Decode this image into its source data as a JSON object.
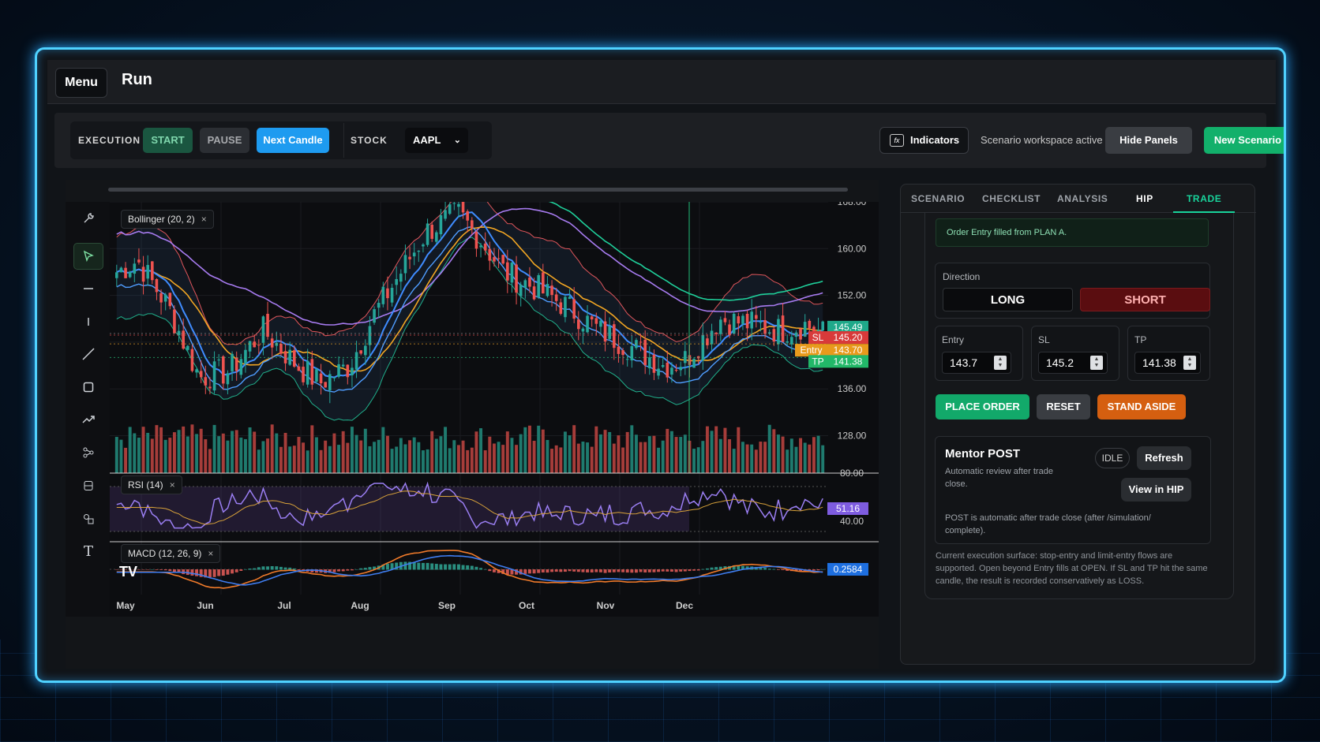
{
  "header": {
    "menu_label": "Menu",
    "title": "Run"
  },
  "toolbar": {
    "execution_label": "EXECUTION",
    "start_label": "START",
    "pause_label": "PAUSE",
    "next_candle_label": "Next Candle",
    "stock_label": "STOCK",
    "stock_value": "AAPL",
    "indicators_label": "Indicators",
    "indicators_icon": "fx",
    "workspace_status": "Scenario workspace active",
    "hide_panels_label": "Hide Panels",
    "new_scenario_label": "New Scenario"
  },
  "chart": {
    "legends": {
      "bollinger": "Bollinger (20, 2)",
      "rsi": "RSI (14)",
      "macd": "MACD (12, 26, 9)"
    },
    "close_glyph": "×",
    "price_ticks": [
      "168.00",
      "160.00",
      "152.00",
      "136.00",
      "128.00"
    ],
    "rsi_ticks": [
      "80.00",
      "40.00"
    ],
    "x_ticks": [
      "May",
      "Jun",
      "Jul",
      "Aug",
      "Sep",
      "Oct",
      "Nov",
      "Dec"
    ],
    "price_labels": {
      "last": "145.49",
      "sl_tag": "SL",
      "sl": "145.20",
      "entry_tag": "Entry",
      "entry": "143.70",
      "tp_tag": "TP",
      "tp": "141.38"
    },
    "rsi_value": "51.16",
    "macd_value": "0.2584",
    "logo": "TV",
    "colors": {
      "up": "#26a69a",
      "down": "#ef5350",
      "bollinger": "#e0565b",
      "ma_fast": "#3f8cff",
      "ma_slow": "#f2a623",
      "ma_long": "#a77bf0",
      "ma_xlong": "#1fcf9a"
    }
  },
  "panel": {
    "tabs": [
      "SCENARIO",
      "CHECKLIST",
      "ANALYSIS",
      "HIP",
      "TRADE"
    ],
    "notice": "Order Entry filled from PLAN A.",
    "direction_label": "Direction",
    "long_label": "LONG",
    "short_label": "SHORT",
    "entry_label": "Entry",
    "entry_value": "143.7",
    "sl_label": "SL",
    "sl_value": "145.2",
    "tp_label": "TP",
    "tp_value": "141.38",
    "place_order_label": "PLACE ORDER",
    "reset_label": "RESET",
    "stand_aside_label": "STAND ASIDE",
    "mentor": {
      "title": "Mentor POST",
      "subtitle": "Automatic review after trade close.",
      "status": "IDLE",
      "refresh_label": "Refresh",
      "view_hip_label": "View in HIP",
      "note": "POST is automatic after trade close (after /simulation/ complete)."
    },
    "execution_note": "Current execution surface: stop-entry and limit-entry flows are supported. Open beyond Entry fills at OPEN. If SL and TP hit the same candle, the result is recorded conservatively as LOSS."
  }
}
